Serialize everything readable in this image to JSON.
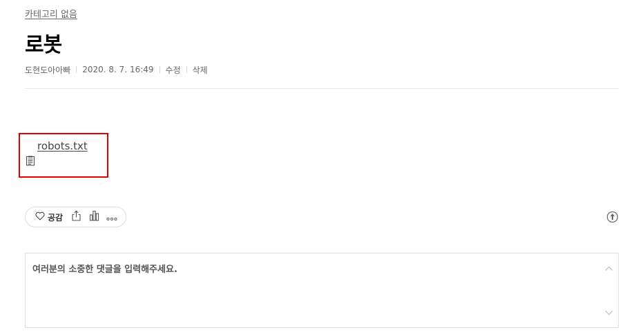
{
  "post": {
    "category": "카테고리 없음",
    "title": "로봇",
    "author": "도현도아아빠",
    "date": "2020. 8. 7. 16:49",
    "edit_label": "수정",
    "delete_label": "삭제"
  },
  "attachment": {
    "filename": " robots.txt",
    "icon": "text-file-icon",
    "highlight_color": "#e20000"
  },
  "actions": {
    "like_label": "공감",
    "icons": [
      "heart-icon",
      "share-icon",
      "stats-icon",
      "more-icon",
      "report-icon"
    ]
  },
  "comment": {
    "placeholder": "여러분의 소중한 댓글을 입력해주세요."
  }
}
